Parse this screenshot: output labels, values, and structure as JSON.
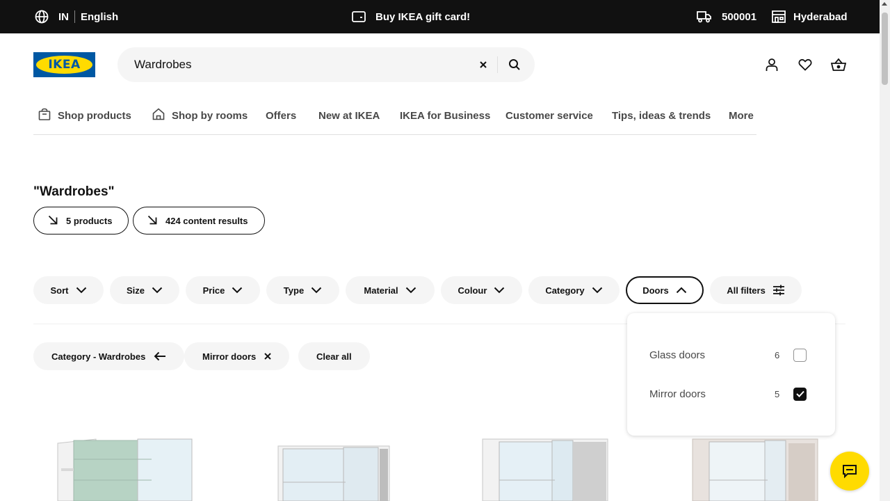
{
  "topbar": {
    "country": "IN",
    "language": "English",
    "gift_card": "Buy IKEA gift card!",
    "pincode": "500001",
    "store": "Hyderabad"
  },
  "header": {
    "logo_text": "IKEA",
    "search": {
      "value": "Wardrobes"
    }
  },
  "nav": {
    "items": [
      {
        "label": "Shop products",
        "icon": "shopping-bag-icon"
      },
      {
        "label": "Shop by rooms",
        "icon": "house-icon"
      },
      {
        "label": "Offers"
      },
      {
        "label": "New at IKEA"
      },
      {
        "label": "IKEA for Business"
      },
      {
        "label": "Customer service"
      },
      {
        "label": "Tips, ideas & trends"
      },
      {
        "label": "More"
      }
    ]
  },
  "results": {
    "title": "\"Wardrobes\"",
    "products_pill": "5 products",
    "content_pill": "424 content results"
  },
  "filters": {
    "buttons": [
      "Sort",
      "Size",
      "Price",
      "Type",
      "Material",
      "Colour",
      "Category",
      "Doors",
      "All filters"
    ],
    "active": "Doors"
  },
  "applied": {
    "chips": [
      "Category - Wardrobes",
      "Mirror doors"
    ],
    "clear_all": "Clear all"
  },
  "doors_dropdown": {
    "options": [
      {
        "label": "Glass doors",
        "count": "6",
        "checked": false
      },
      {
        "label": "Mirror doors",
        "count": "5",
        "checked": true
      }
    ]
  },
  "colors": {
    "brand_blue": "#0058a3",
    "brand_yellow": "#ffdb00",
    "topbar_bg": "#111111"
  }
}
